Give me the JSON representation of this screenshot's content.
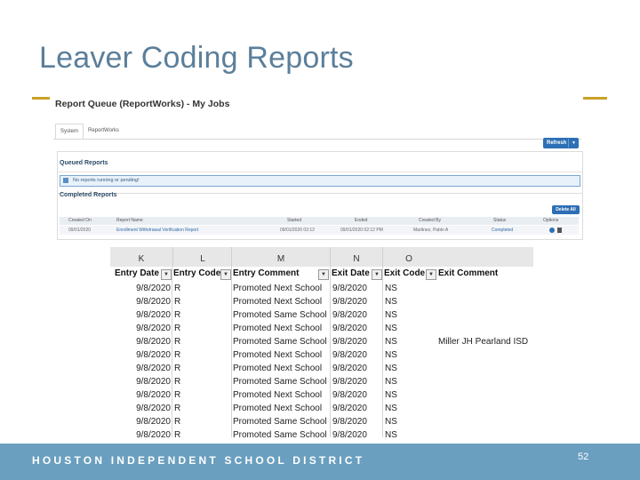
{
  "slide": {
    "title": "Leaver Coding Reports",
    "footer": "HOUSTON INDEPENDENT SCHOOL DISTRICT",
    "page_number": "52"
  },
  "report_queue": {
    "title": "Report Queue (ReportWorks) - My Jobs",
    "tabs": [
      "System",
      "ReportWorks"
    ],
    "refresh_label": "Refresh",
    "queued_title": "Queued Reports",
    "queued_message": "No reports running or pending!",
    "completed_title": "Completed Reports",
    "delete_all_label": "Delete All",
    "columns": [
      "Created On",
      "Report Name",
      "Started",
      "Ended",
      "Created By",
      "Status",
      "Options"
    ],
    "row": {
      "created_on": "09/01/2020",
      "report_name": "Enrollment Withdrawal Verification Report",
      "started": "09/01/2020 02:12",
      "ended": "09/01/2020 02:12 PM",
      "created_by": "Martinez, Pablo A",
      "status": "Completed"
    }
  },
  "sheet": {
    "column_letters": [
      "K",
      "L",
      "M",
      "N",
      "O"
    ],
    "headers": [
      "Entry Date",
      "Entry Code",
      "Entry Comment",
      "Exit Date",
      "Exit Code",
      "Exit Comment"
    ],
    "rows": [
      {
        "entry_date": "9/8/2020",
        "entry_code": "R",
        "entry_comment": "Promoted Next School",
        "exit_date": "9/8/2020",
        "exit_code": "NS",
        "exit_comment": ""
      },
      {
        "entry_date": "9/8/2020",
        "entry_code": "R",
        "entry_comment": "Promoted Next School",
        "exit_date": "9/8/2020",
        "exit_code": "NS",
        "exit_comment": ""
      },
      {
        "entry_date": "9/8/2020",
        "entry_code": "R",
        "entry_comment": "Promoted Same School",
        "exit_date": "9/8/2020",
        "exit_code": "NS",
        "exit_comment": ""
      },
      {
        "entry_date": "9/8/2020",
        "entry_code": "R",
        "entry_comment": "Promoted Next School",
        "exit_date": "9/8/2020",
        "exit_code": "NS",
        "exit_comment": ""
      },
      {
        "entry_date": "9/8/2020",
        "entry_code": "R",
        "entry_comment": "Promoted Same School",
        "exit_date": "9/8/2020",
        "exit_code": "NS",
        "exit_comment": "Miller JH   Pearland ISD"
      },
      {
        "entry_date": "9/8/2020",
        "entry_code": "R",
        "entry_comment": "Promoted Next School",
        "exit_date": "9/8/2020",
        "exit_code": "NS",
        "exit_comment": ""
      },
      {
        "entry_date": "9/8/2020",
        "entry_code": "R",
        "entry_comment": "Promoted Next School",
        "exit_date": "9/8/2020",
        "exit_code": "NS",
        "exit_comment": ""
      },
      {
        "entry_date": "9/8/2020",
        "entry_code": "R",
        "entry_comment": "Promoted Same School",
        "exit_date": "9/8/2020",
        "exit_code": "NS",
        "exit_comment": ""
      },
      {
        "entry_date": "9/8/2020",
        "entry_code": "R",
        "entry_comment": "Promoted Next School",
        "exit_date": "9/8/2020",
        "exit_code": "NS",
        "exit_comment": ""
      },
      {
        "entry_date": "9/8/2020",
        "entry_code": "R",
        "entry_comment": "Promoted Next School",
        "exit_date": "9/8/2020",
        "exit_code": "NS",
        "exit_comment": ""
      },
      {
        "entry_date": "9/8/2020",
        "entry_code": "R",
        "entry_comment": "Promoted Same School",
        "exit_date": "9/8/2020",
        "exit_code": "NS",
        "exit_comment": ""
      },
      {
        "entry_date": "9/8/2020",
        "entry_code": "R",
        "entry_comment": "Promoted Same School",
        "exit_date": "9/8/2020",
        "exit_code": "NS",
        "exit_comment": ""
      }
    ]
  },
  "colors": {
    "title": "#5b7f9b",
    "accent_gold": "#c9a227",
    "footer_bar": "#6a9fbf",
    "button_blue": "#2d6fb4"
  }
}
